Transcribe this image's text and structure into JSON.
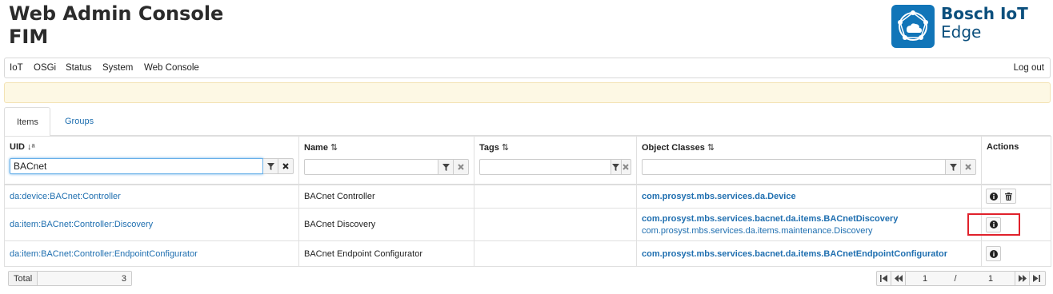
{
  "header": {
    "title_line1": "Web Admin Console",
    "title_line2": "FIM"
  },
  "logo": {
    "line1": "Bosch IoT",
    "line2": "Edge"
  },
  "nav": {
    "items": [
      "IoT",
      "OSGi",
      "Status",
      "System",
      "Web Console"
    ],
    "logout": "Log out"
  },
  "tabs": [
    {
      "label": "Items",
      "active": true
    },
    {
      "label": "Groups",
      "active": false
    }
  ],
  "table": {
    "columns": [
      {
        "label": "UID",
        "filter_value": "BACnet"
      },
      {
        "label": "Name",
        "filter_value": ""
      },
      {
        "label": "Tags",
        "filter_value": ""
      },
      {
        "label": "Object Classes",
        "filter_value": ""
      },
      {
        "label": "Actions"
      }
    ],
    "rows": [
      {
        "uid": "da:device:BACnet:Controller",
        "name": "BACnet Controller",
        "tags": "",
        "object_classes": [
          "com.prosyst.mbs.services.da.Device"
        ],
        "actions": [
          "info",
          "delete"
        ]
      },
      {
        "uid": "da:item:BACnet:Controller:Discovery",
        "name": "BACnet Discovery",
        "tags": "",
        "object_classes": [
          "com.prosyst.mbs.services.bacnet.da.items.BACnetDiscovery",
          "com.prosyst.mbs.services.da.items.maintenance.Discovery"
        ],
        "actions": [
          "info"
        ]
      },
      {
        "uid": "da:item:BACnet:Controller:EndpointConfigurator",
        "name": "BACnet Endpoint Configurator",
        "tags": "",
        "object_classes": [
          "com.prosyst.mbs.services.bacnet.da.items.BACnetEndpointConfigurator"
        ],
        "actions": [
          "info"
        ]
      }
    ]
  },
  "footer": {
    "total_label": "Total",
    "total_value": "3"
  },
  "pager": {
    "current_page": "1",
    "separator": "/",
    "total_pages": "1"
  },
  "colors": {
    "link": "#1f6fb0",
    "logo_blue": "#1175b8",
    "highlight": "#e0212b",
    "alert_bg": "#fdf8e4"
  },
  "icons": [
    "filter-icon",
    "clear-icon",
    "sort-icon",
    "info-icon",
    "trash-icon",
    "first-page-icon",
    "prev-page-icon",
    "next-page-icon",
    "last-page-icon"
  ]
}
